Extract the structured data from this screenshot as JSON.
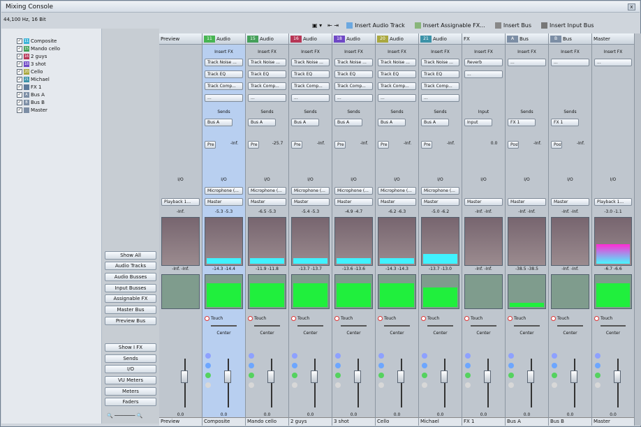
{
  "window": {
    "title": "Mixing Console",
    "sample_rate": "44,100 Hz, 16 Bit"
  },
  "toolbar": {
    "insert_audio": "Insert Audio Track",
    "insert_assignable": "Insert Assignable FX...",
    "insert_bus": "Insert Bus",
    "insert_input_bus": "Insert Input Bus"
  },
  "tree": [
    {
      "num": "11",
      "label": "Composite",
      "color": "#3bb4d8"
    },
    {
      "num": "15",
      "label": "Mando cello",
      "color": "#45a05a"
    },
    {
      "num": "16",
      "label": "2 guys",
      "color": "#b73656"
    },
    {
      "num": "18",
      "label": "3 shot",
      "color": "#6f48c6"
    },
    {
      "num": "20",
      "label": "Cello",
      "color": "#aaa83f"
    },
    {
      "num": "21",
      "label": "Michael",
      "color": "#3c92a8"
    },
    {
      "num": "",
      "label": "FX 1",
      "color": "#5c7a9a"
    },
    {
      "num": "A",
      "label": "Bus A",
      "color": "#7c8ea5"
    },
    {
      "num": "B",
      "label": "Bus B",
      "color": "#7c8ea5"
    },
    {
      "num": "",
      "label": "Master",
      "color": "#7c8ea5"
    }
  ],
  "sidebar_buttons": [
    "Show All",
    "Audio Tracks",
    "Audio Busses",
    "Input Busses",
    "Assignable FX",
    "Master Bus",
    "Preview Bus",
    "Show I FX",
    "Sends",
    "I/O",
    "VU Meters",
    "Meters",
    "Faders"
  ],
  "channels": [
    {
      "name": "Preview",
      "top_num": "",
      "top_label": "Preview",
      "io": "I/O",
      "out": "Playback 1...",
      "meter_top": [
        "",
        "-Inf."
      ],
      "meter_bottom": [
        "-Inf.",
        "-Inf."
      ],
      "value": "0.0",
      "fader": "0.0",
      "color": "#b8c0c8"
    },
    {
      "name": "Composite",
      "top_num": "11",
      "top_label": "Audio",
      "io": "I/O",
      "out": "Master",
      "meter_top": [
        "-5.3",
        "-5.3"
      ],
      "meter_bottom": [
        "-14.3",
        "-14.4"
      ],
      "value": "0.0",
      "fader": "0.0",
      "color": "#47b552",
      "fx": [
        "Track Noise ...",
        "Track EQ",
        "Track Comp...",
        "..."
      ],
      "sends": "Bus A",
      "send_val": "-Inf.",
      "pre": "Pre",
      "mic": "Microphone (..."
    },
    {
      "name": "Mando cello",
      "top_num": "15",
      "top_label": "Audio",
      "io": "I/O",
      "out": "Master",
      "meter_top": [
        "-6.5",
        "-5.3"
      ],
      "meter_bottom": [
        "-11.9",
        "-11.8"
      ],
      "value": "0.0",
      "fader": "0.0",
      "color": "#45a05a",
      "fx": [
        "Track Noise ...",
        "Track EQ",
        "Track Comp...",
        "..."
      ],
      "sends": "Bus A",
      "send_val": "-25.7",
      "pre": "Pre",
      "mic": "Microphone (..."
    },
    {
      "name": "2 guys",
      "top_num": "16",
      "top_label": "Audio",
      "io": "I/O",
      "out": "Master",
      "meter_top": [
        "-5.4",
        "-5.3"
      ],
      "meter_bottom": [
        "-13.7",
        "-13.7"
      ],
      "value": "0.0",
      "fader": "0.0",
      "color": "#b73656",
      "fx": [
        "Track Noise ...",
        "Track EQ",
        "Track Comp...",
        "..."
      ],
      "sends": "Bus A",
      "send_val": "-Inf.",
      "pre": "Pre",
      "mic": "Microphone (..."
    },
    {
      "name": "3 shot",
      "top_num": "18",
      "top_label": "Audio",
      "io": "I/O",
      "out": "Master",
      "meter_top": [
        "-4.9",
        "-4.7"
      ],
      "meter_bottom": [
        "-13.6",
        "-13.6"
      ],
      "value": "0.0",
      "fader": "0.0",
      "color": "#6f48c6",
      "fx": [
        "Track Noise ...",
        "Track EQ",
        "Track Comp...",
        "..."
      ],
      "sends": "Bus A",
      "send_val": "-Inf.",
      "pre": "Pre",
      "mic": "Microphone (..."
    },
    {
      "name": "Cello",
      "top_num": "20",
      "top_label": "Audio",
      "io": "I/O",
      "out": "Master",
      "meter_top": [
        "-6.2",
        "-6.3"
      ],
      "meter_bottom": [
        "-14.3",
        "-14.3"
      ],
      "value": "0.0",
      "fader": "0.0",
      "color": "#aaa83f",
      "fx": [
        "Track Noise ...",
        "Track EQ",
        "Track Comp...",
        "..."
      ],
      "sends": "Bus A",
      "send_val": "-Inf.",
      "pre": "Pre",
      "mic": "Microphone (..."
    },
    {
      "name": "Michael",
      "top_num": "21",
      "top_label": "Audio",
      "io": "I/O",
      "out": "Master",
      "meter_top": [
        "-5.0",
        "-6.2"
      ],
      "meter_bottom": [
        "-13.7",
        "-13.0"
      ],
      "value": "0.0",
      "fader": "0.0",
      "color": "#3c92a8",
      "fx": [
        "Track Noise ...",
        "Track EQ",
        "Track Comp...",
        "..."
      ],
      "sends": "Bus A",
      "send_val": "-Inf.",
      "pre": "Pre",
      "mic": "Microphone (..."
    },
    {
      "name": "FX 1",
      "top_num": "",
      "top_label": "FX",
      "io": "I/O",
      "out": "Master",
      "meter_top": [
        "-Inf.",
        "-Inf."
      ],
      "meter_bottom": [
        "-Inf.",
        "-Inf."
      ],
      "value": "0.0",
      "fader": "0.0",
      "color": "#5c7a9a",
      "fx": [
        "Reverb",
        "..."
      ],
      "sends": "Input",
      "send_val": "0.0",
      "pre": "",
      "mic": ""
    },
    {
      "name": "Bus A",
      "top_num": "A",
      "top_label": "Bus",
      "io": "I/O",
      "out": "Master",
      "meter_top": [
        "-Inf.",
        "-Inf."
      ],
      "meter_bottom": [
        "-38.5",
        "-38.5"
      ],
      "value": "0.0",
      "fader": "0.0",
      "color": "#7c8ea5",
      "fx": [
        "..."
      ],
      "sends": "FX 1",
      "send_val": "-Inf.",
      "pre": "Post",
      "mic": ""
    },
    {
      "name": "Bus B",
      "top_num": "B",
      "top_label": "Bus",
      "io": "I/O",
      "out": "Master",
      "meter_top": [
        "-Inf.",
        "-Inf."
      ],
      "meter_bottom": [
        "-Inf.",
        "-Inf."
      ],
      "value": "0.0",
      "fader": "0.0",
      "color": "#7c8ea5",
      "fx": [
        "..."
      ],
      "sends": "FX 1",
      "send_val": "-Inf.",
      "pre": "Post",
      "mic": ""
    },
    {
      "name": "Master",
      "top_num": "",
      "top_label": "Master",
      "io": "I/O",
      "out": "Playback 1...",
      "meter_top": [
        "-3.0",
        "-1.1"
      ],
      "meter_bottom": [
        "-6.7",
        "-6.6"
      ],
      "value": "0.0",
      "fader": "0.0",
      "color": "#7c8ea5",
      "fx": [
        "..."
      ],
      "sends": "",
      "send_val": "",
      "pre": "",
      "mic": ""
    }
  ],
  "labels": {
    "touch": "Touch",
    "center": "Center",
    "sends": "Sends",
    "insert_fx": "Insert FX",
    "input": "Input"
  }
}
